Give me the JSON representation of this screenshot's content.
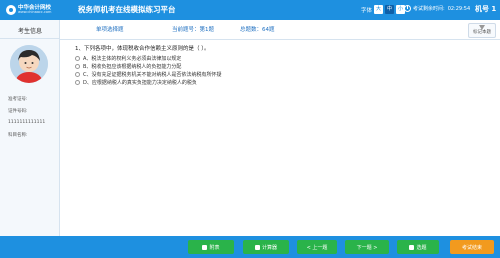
{
  "header": {
    "logo_cn": "中华会计网校",
    "logo_url": "www.chinaacc.com",
    "app_title": "税务师机考在线模拟练习平台",
    "font_label": "字体",
    "font_sizes": [
      "大",
      "中",
      "小"
    ],
    "timer_label": "考试剩余时间:",
    "timer_value": "02:29:54",
    "machine_label": "机号 1"
  },
  "left_panel": {
    "title": "考生信息",
    "admission_label": "准考证号:",
    "id_label": "证件号码:",
    "id_value": "1111111111111",
    "subject_label": "科目名称:"
  },
  "info_bar": {
    "question_type": "单项选择题",
    "current": "当前题号：第1题",
    "total": "总题数：64题",
    "flag_label": "标记本题"
  },
  "question": {
    "stem": "1、下列各项中，体现税收合作信赖主义原则的是（  ）。",
    "options": [
      "A、税法主体的权利义务必须由法律加以规定",
      "B、税收负担应该根据纳税人的负担能力分配",
      "C、没有充足证据税务机关不能对纳税人是否依法纳税有所怀疑",
      "D、应根据纳税人的真实负担能力决定纳税人的税负"
    ]
  },
  "footer": {
    "buttons": [
      "附表",
      "计算器",
      "< 上一题",
      "下一题 >",
      "选题",
      "考试结束"
    ]
  },
  "colors": {
    "primary_blue": "#1e90e0",
    "button_green": "#2ab34a",
    "button_orange": "#f29a1e"
  }
}
